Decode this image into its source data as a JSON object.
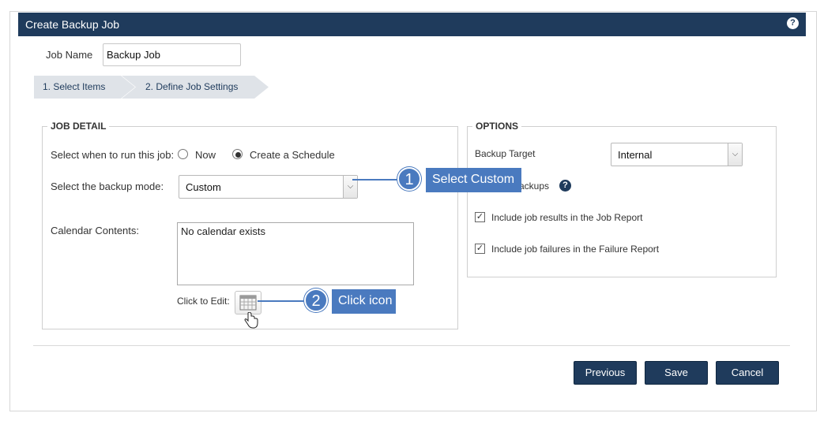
{
  "dialog": {
    "title": "Create Backup Job",
    "help_icon": "?"
  },
  "job_name": {
    "label": "Job Name",
    "value": "Backup Job"
  },
  "steps": [
    {
      "label": "1. Select Items"
    },
    {
      "label": "2. Define Job Settings"
    }
  ],
  "job_detail": {
    "legend": "JOB DETAIL",
    "run_label": "Select when to run this job:",
    "run_options": [
      {
        "label": "Now",
        "selected": false
      },
      {
        "label": "Create a Schedule",
        "selected": true
      }
    ],
    "mode_label": "Select the backup mode:",
    "mode_value": "Custom",
    "calendar_label": "Calendar Contents:",
    "calendar_text": "No calendar exists",
    "click_to_edit": "Click to Edit:",
    "calendar_icon": "calendar-icon"
  },
  "options": {
    "legend": "OPTIONS",
    "target_label": "Backup Target",
    "target_value": "Internal",
    "backups_label": "ackups",
    "checkboxes": [
      {
        "label": "Include job results in the Job Report",
        "checked": true
      },
      {
        "label": "Include job failures in the Failure Report",
        "checked": true
      }
    ]
  },
  "buttons": {
    "previous": "Previous",
    "save": "Save",
    "cancel": "Cancel"
  },
  "callouts": [
    {
      "number": "1",
      "text": "Select Custom"
    },
    {
      "number": "2",
      "text": "Click icon"
    }
  ],
  "colors": {
    "header": "#1f3b5c",
    "callout": "#4a7abf",
    "step_bg": "#dfe3e8"
  }
}
